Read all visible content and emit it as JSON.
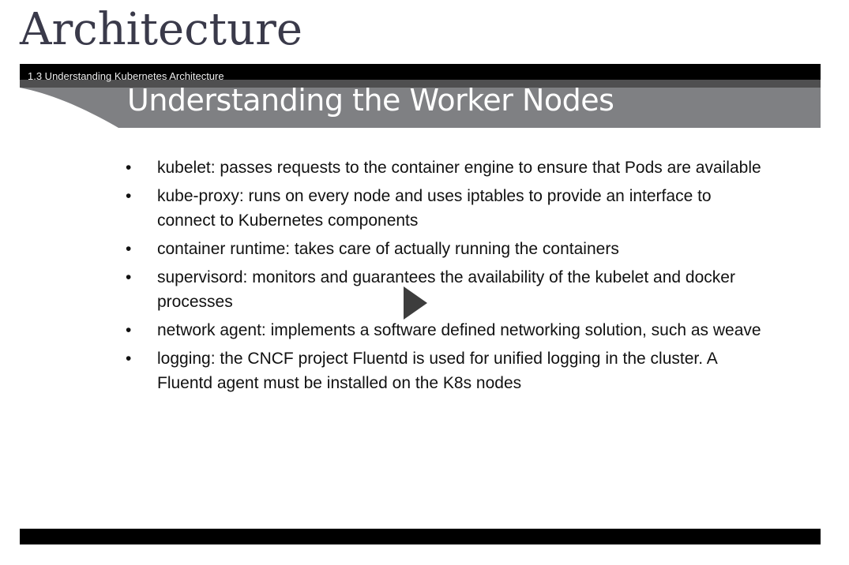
{
  "page_title": "Architecture",
  "video": {
    "label": "1.3 Understanding Kubernetes Architecture",
    "slide_title": "Understanding the Worker Nodes",
    "bullets": [
      "kubelet: passes requests to the container engine to ensure that Pods are available",
      "kube-proxy: runs on every node and uses iptables to provide an interface to connect to Kubernetes components",
      "container runtime: takes care of actually running the containers",
      "supervisord: monitors and guarantees the availability of the kubelet and docker processes",
      "network agent: implements a software defined networking solution, such as weave",
      "logging: the CNCF project Fluentd is used for unified logging in the cluster. A Fluentd agent must be installed on the K8s nodes"
    ],
    "bullet_char": "•"
  }
}
